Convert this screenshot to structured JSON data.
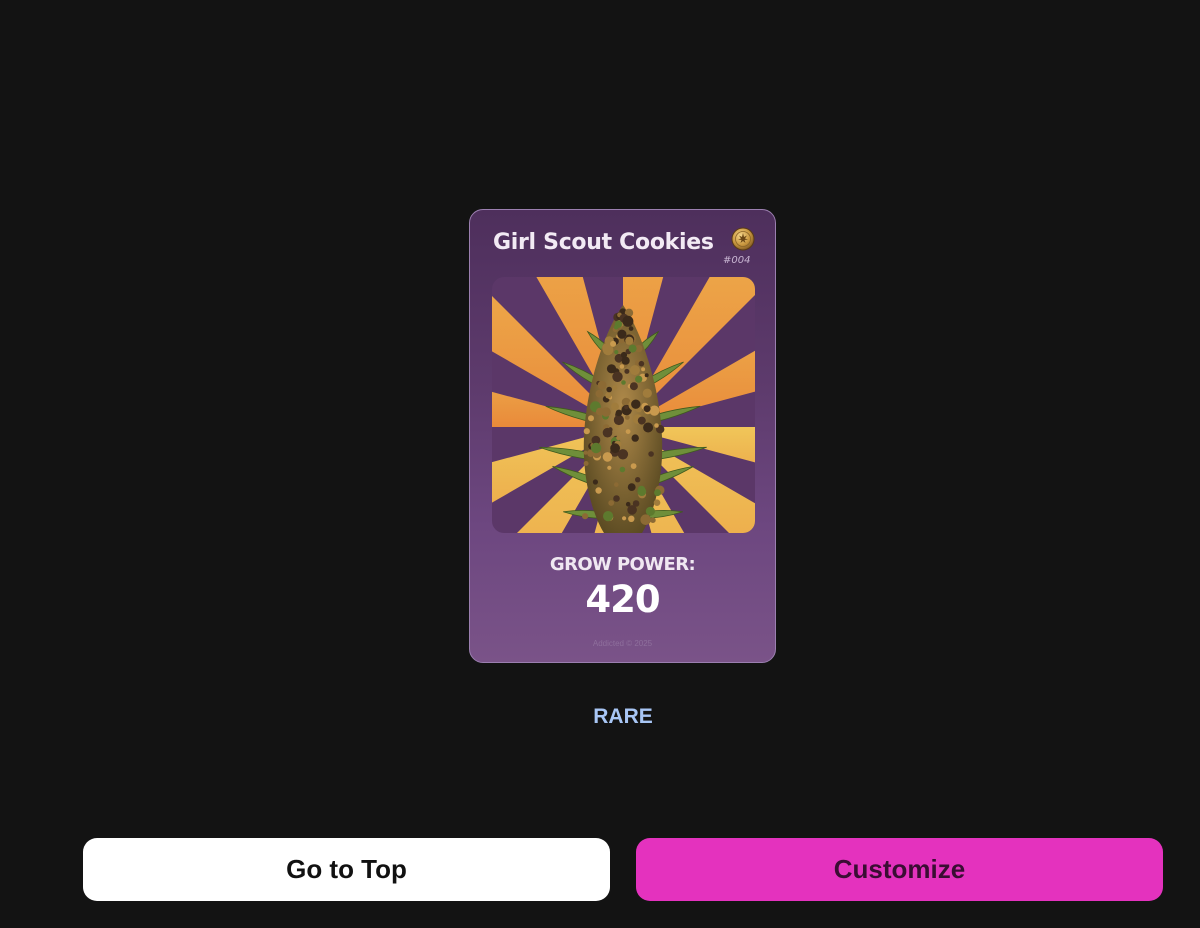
{
  "card": {
    "title": "Girl Scout Cookies",
    "number": "#004",
    "stat_label": "GROW POWER:",
    "stat_value": "420",
    "footer": "Addicted © 2025",
    "badge_icon": "coin-leaf-icon",
    "artwork": "cannabis-bud-sunburst-image"
  },
  "rarity": "RARE",
  "buttons": {
    "go_to_top": "Go to Top",
    "customize": "Customize"
  },
  "colors": {
    "background": "#131313",
    "card_purple": "#5e3b6d",
    "rarity_blue": "#a8c6f5",
    "customize_pink": "#e432be",
    "go_to_top_white": "#ffffff"
  }
}
